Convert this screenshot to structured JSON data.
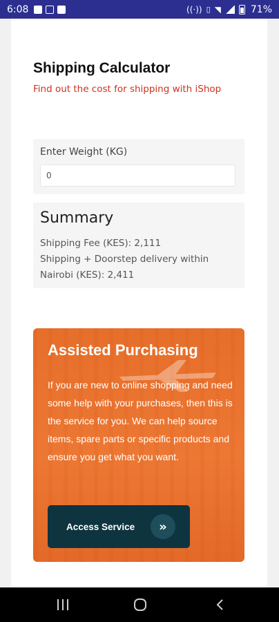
{
  "status_bar": {
    "time": "6:08",
    "battery": "71%"
  },
  "calculator": {
    "title": "Shipping Calculator",
    "subtitle": "Find out the cost for shipping with iShop",
    "weight_label": "Enter Weight (KG)",
    "weight_value": "0"
  },
  "summary": {
    "title": "Summary",
    "shipping_fee": "Shipping Fee (KES): 2,111",
    "doorstep": "Shipping + Doorstep delivery within Nairobi (KES): 2,411"
  },
  "promo": {
    "title": "Assisted Purchasing",
    "text": "If you are new to online shopping and need some help with your purchases, then this is the service for you. We can help source items, spare parts or specific products and ensure you get what you want.",
    "button_label": "Access Service",
    "button_icon": "»",
    "colors": {
      "accent": "#e8702c",
      "button": "#0e3440"
    }
  },
  "colors": {
    "status_bar": "#2c2f8f",
    "subtitle": "#d0311f"
  }
}
